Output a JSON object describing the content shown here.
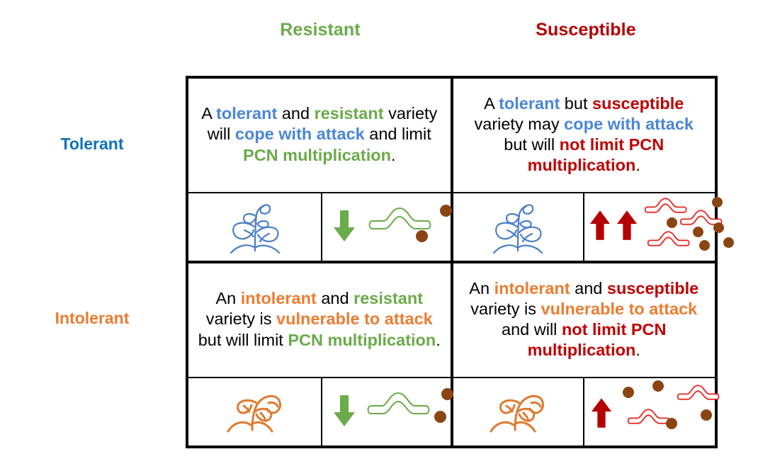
{
  "colors": {
    "resistant_green": "#6aab4a",
    "susceptible_red": "#b40000",
    "tolerant_blue": "#0f72bd",
    "intolerant_orange": "#ec7c30",
    "text_blue": "#4a86d8",
    "text_red": "#c00000",
    "cyst_brown": "#8a4513",
    "nematode_red": "#e8201a",
    "arrow_red": "#b40000",
    "arrow_green": "#6aab4a",
    "border_black": "#000000"
  },
  "headers": {
    "columns": [
      {
        "id": "resistant",
        "label": "Resistant"
      },
      {
        "id": "susceptible",
        "label": "Susceptible"
      }
    ],
    "rows": [
      {
        "id": "tolerant",
        "label": "Tolerant"
      },
      {
        "id": "intolerant",
        "label": "Intolerant"
      }
    ]
  },
  "quadrants": {
    "tolerant_resistant": {
      "row": "Tolerant",
      "column": "Resistant",
      "text_plain": "A tolerant and resistant variety will cope with attack and limit PCN multiplication.",
      "segments": [
        {
          "text": "A ",
          "color": "black"
        },
        {
          "text": "tolerant",
          "color": "blue"
        },
        {
          "text": " and ",
          "color": "black"
        },
        {
          "text": "resistant",
          "color": "green"
        },
        {
          "text": " variety will ",
          "color": "black"
        },
        {
          "text": "cope with attack",
          "color": "blue"
        },
        {
          "text": " and limit ",
          "color": "black"
        },
        {
          "text": "PCN multiplication",
          "color": "green"
        },
        {
          "text": ".",
          "color": "black"
        }
      ],
      "icons": {
        "plant": "healthy-seedling-icon",
        "plant_color": "blue",
        "arrow": "down-arrow-icon",
        "arrow_count": 1,
        "arrow_color": "green",
        "nematode_count": 1,
        "nematode_color": "green",
        "cyst_count": 2
      }
    },
    "tolerant_susceptible": {
      "row": "Tolerant",
      "column": "Susceptible",
      "text_plain": "A tolerant but susceptible variety may cope with attack but will not limit PCN multiplication.",
      "segments": [
        {
          "text": "A ",
          "color": "black"
        },
        {
          "text": "tolerant",
          "color": "blue"
        },
        {
          "text": " but ",
          "color": "black"
        },
        {
          "text": "susceptible",
          "color": "red"
        },
        {
          "text": " variety may ",
          "color": "black"
        },
        {
          "text": "cope with attack",
          "color": "blue"
        },
        {
          "text": " but will ",
          "color": "black"
        },
        {
          "text": "not limit PCN multiplication",
          "color": "red"
        },
        {
          "text": ".",
          "color": "black"
        }
      ],
      "icons": {
        "plant": "healthy-seedling-icon",
        "plant_color": "blue",
        "arrow": "up-arrow-icon",
        "arrow_count": 2,
        "arrow_color": "red",
        "nematode_count": 3,
        "nematode_color": "red",
        "cyst_count": 6
      }
    },
    "intolerant_resistant": {
      "row": "Intolerant",
      "column": "Resistant",
      "text_plain": "An intolerant and resistant variety is vulnerable to attack but will limit PCN multiplication.",
      "segments": [
        {
          "text": "An ",
          "color": "black"
        },
        {
          "text": "intolerant",
          "color": "orange"
        },
        {
          "text": " and ",
          "color": "black"
        },
        {
          "text": "resistant",
          "color": "green"
        },
        {
          "text": " variety is ",
          "color": "black"
        },
        {
          "text": "vulnerable to attack",
          "color": "orange"
        },
        {
          "text": " but will limit ",
          "color": "black"
        },
        {
          "text": "PCN multiplication",
          "color": "green"
        },
        {
          "text": ".",
          "color": "black"
        }
      ],
      "icons": {
        "plant": "wilting-plant-icon",
        "plant_color": "orange",
        "arrow": "down-arrow-icon",
        "arrow_count": 1,
        "arrow_color": "green",
        "nematode_count": 1,
        "nematode_color": "green",
        "cyst_count": 2
      }
    },
    "intolerant_susceptible": {
      "row": "Intolerant",
      "column": "Susceptible",
      "text_plain": "An intolerant and susceptible variety is vulnerable to attack and will not limit PCN multiplication.",
      "segments": [
        {
          "text": "An ",
          "color": "black"
        },
        {
          "text": "intolerant",
          "color": "orange"
        },
        {
          "text": " and ",
          "color": "black"
        },
        {
          "text": "susceptible",
          "color": "red"
        },
        {
          "text": " variety is ",
          "color": "black"
        },
        {
          "text": "vulnerable to attack",
          "color": "orange"
        },
        {
          "text": " and will ",
          "color": "black"
        },
        {
          "text": "not limit PCN multiplication",
          "color": "red"
        },
        {
          "text": ".",
          "color": "black"
        }
      ],
      "icons": {
        "plant": "wilting-plant-icon",
        "plant_color": "orange",
        "arrow": "up-arrow-icon",
        "arrow_count": 1,
        "arrow_color": "red",
        "nematode_count": 2,
        "nematode_color": "red",
        "cyst_count": 4
      }
    }
  }
}
